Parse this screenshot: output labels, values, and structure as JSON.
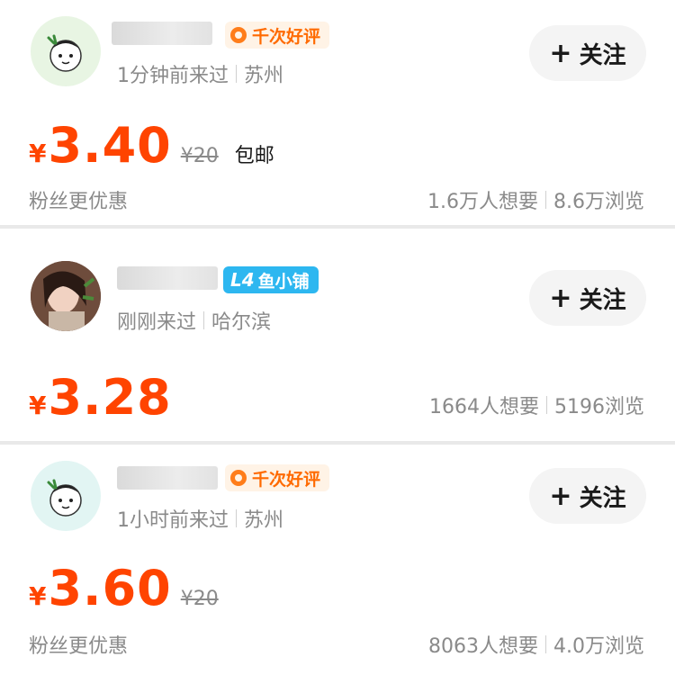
{
  "listings": [
    {
      "badge": "千次好评",
      "visit": "1分钟前来过",
      "city": "苏州",
      "currency": "¥",
      "price": "3.40",
      "original_price": "¥20",
      "shipping": "包邮",
      "fans_text": "粉丝更优惠",
      "wants": "1.6万人想要",
      "views": "8.6万浏览",
      "follow_label": "关注",
      "avatar_icon": "cartoon-avatar-icon"
    },
    {
      "badge_level": "L4",
      "badge": "鱼小铺",
      "visit": "刚刚来过",
      "city": "哈尔滨",
      "currency": "¥",
      "price": "3.28",
      "wants": "1664人想要",
      "views": "5196浏览",
      "follow_label": "关注",
      "avatar_icon": "photo-avatar"
    },
    {
      "badge": "千次好评",
      "visit": "1小时前来过",
      "city": "苏州",
      "currency": "¥",
      "price": "3.60",
      "original_price": "¥20",
      "fans_text": "粉丝更优惠",
      "wants": "8063人想要",
      "views": "4.0万浏览",
      "follow_label": "关注",
      "avatar_icon": "cartoon-avatar-icon"
    }
  ],
  "colors": {
    "price": "#ff4400",
    "badge_orange": "#ff6a00",
    "badge_blue": "#2db7f0",
    "muted": "#8a8a8a"
  }
}
